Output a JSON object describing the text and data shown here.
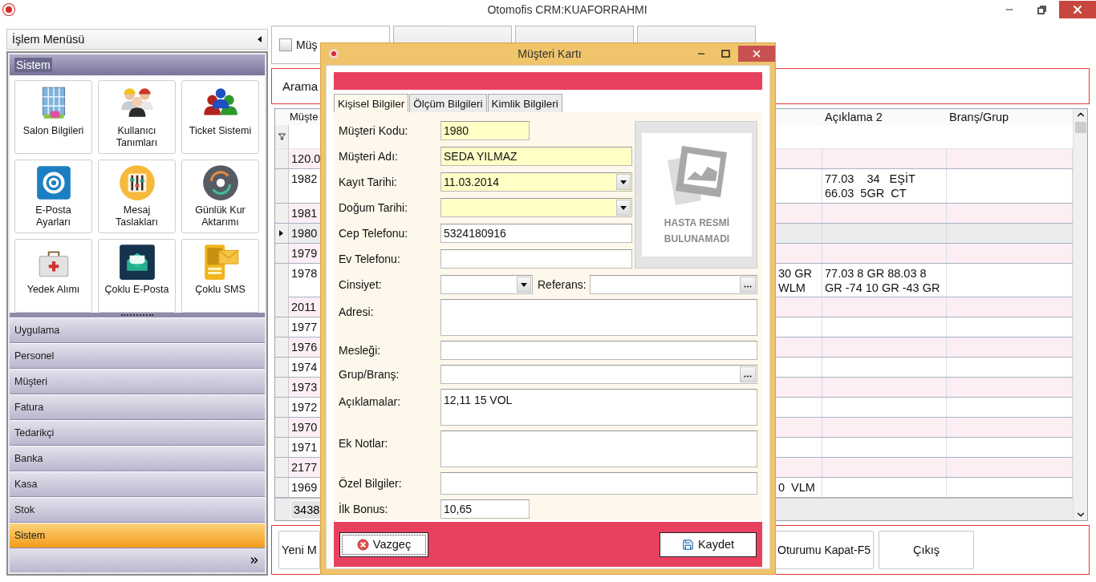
{
  "window": {
    "title": "Otomofis CRM:KUAFORRAHMI"
  },
  "sidebar": {
    "title": "İşlem Menüsü",
    "group": "Sistem",
    "tiles": [
      "Salon Bilgileri",
      "Kullanıcı Tanımları",
      "Ticket Sistemi",
      "E-Posta Ayarları",
      "Mesaj Taslakları",
      "Günlük Kur Aktarımı",
      "Yedek Alımı",
      "Çoklu E-Posta",
      "Çoklu SMS"
    ],
    "items": [
      {
        "label": "Uygulama",
        "selected": false
      },
      {
        "label": "Personel",
        "selected": false
      },
      {
        "label": "Müşteri",
        "selected": false
      },
      {
        "label": "Fatura",
        "selected": false
      },
      {
        "label": "Tedarikçi",
        "selected": false
      },
      {
        "label": "Banka",
        "selected": false
      },
      {
        "label": "Kasa",
        "selected": false
      },
      {
        "label": "Stok",
        "selected": false
      },
      {
        "label": "Sistem",
        "selected": true
      }
    ]
  },
  "tabs": [
    {
      "label": "Müş",
      "selected": true,
      "checked": false
    },
    {
      "selected": false
    },
    {
      "selected": false
    },
    {
      "selected": false
    }
  ],
  "search": {
    "label": "Arama"
  },
  "table": {
    "columns": [
      "Müşte",
      "Açıklama 2",
      "Branş/Grup"
    ],
    "rows": [
      {
        "column_1": "120.0",
        "selected": false
      },
      {
        "column_1": "1982",
        "aciklama_2": "77.03    34   EŞİT\n66.03  5GR  CT",
        "selected": false
      },
      {
        "column_1": "1981",
        "selected": false
      },
      {
        "column_1": "1980",
        "selected": true
      },
      {
        "column_1": "1979",
        "selected": false
      },
      {
        "column_1": "1978",
        "column_3": "30 GR\nWLM",
        "aciklama_2": "77.03 8 GR 88.03 8\nGR -74 10 GR -43 GR",
        "selected": false
      },
      {
        "column_1": "2011",
        "selected": false
      },
      {
        "column_1": "1977",
        "selected": false
      },
      {
        "column_1": "1976",
        "selected": false
      },
      {
        "column_1": "1974",
        "selected": false
      },
      {
        "column_1": "1973",
        "selected": false
      },
      {
        "column_1": "1972",
        "selected": false
      },
      {
        "column_1": "1970",
        "selected": false
      },
      {
        "column_1": "1971",
        "selected": false
      },
      {
        "column_1": "2177",
        "selected": false
      },
      {
        "column_1": "1969",
        "column_3": "0  VLM",
        "selected": false
      }
    ],
    "footer": "3438"
  },
  "buttons": [
    "Yeni M",
    "Oturumu Kapat-F5",
    "Çıkış"
  ],
  "dialog": {
    "title": "Müşteri Kartı",
    "tabs": [
      {
        "label": "Kişisel Bilgiler",
        "selected": true
      },
      {
        "label": "Ölçüm Bilgileri",
        "selected": false
      },
      {
        "label": "Kimlik Bilgileri",
        "selected": false
      }
    ],
    "fields": [
      {
        "label": "Müşteri Kodu:",
        "kind": "short",
        "value": "1980",
        "required": true
      },
      {
        "label": "Müşteri Adı:",
        "kind": "text",
        "value": "SEDA YILMAZ",
        "required": true
      },
      {
        "label": "Kayıt Tarihi:",
        "kind": "dropdown",
        "value": "11.03.2014",
        "required": true
      },
      {
        "label": "Doğum Tarihi:",
        "kind": "dropdown",
        "required": true
      },
      {
        "label": "Cep Telefonu:",
        "kind": "text",
        "value": "5324180916",
        "required": false
      },
      {
        "label": "Ev Telefonu:",
        "kind": "text",
        "required": false
      }
    ],
    "photo_caption": "HASTA RESMİ BULUNAMADI",
    "more_fields": [
      {
        "label": "Cinsiyet:",
        "kind": "select",
        "required": false,
        "extra": {
          "label": "Referans:",
          "kind": "lookup",
          "required": false
        }
      },
      {
        "label": "Adresi:",
        "kind": "memo",
        "required": false
      },
      {
        "label": "Mesleği:",
        "kind": "text",
        "required": false
      },
      {
        "label": "Grup/Branş:",
        "kind": "lookup",
        "required": false
      },
      {
        "label": "Açıklamalar:",
        "kind": "memo",
        "value": "12,11 15 VOL",
        "required": false
      },
      {
        "label": "Ek Notlar:",
        "kind": "memo",
        "required": false
      },
      {
        "label": "Özel Bilgiler:",
        "kind": "text",
        "required": false
      },
      {
        "label": "İlk Bonus:",
        "kind": "short",
        "value": "10,65",
        "required": false
      }
    ],
    "buttons": [
      {
        "label": "Vazgeç",
        "kind": "cancel"
      },
      {
        "label": "Kaydet",
        "kind": "save"
      }
    ]
  }
}
